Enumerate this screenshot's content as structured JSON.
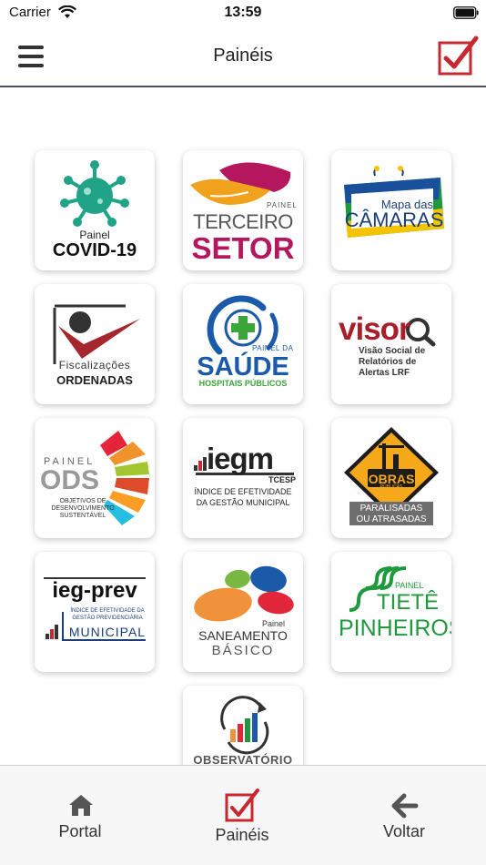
{
  "status_bar": {
    "carrier": "Carrier",
    "time": "13:59"
  },
  "nav": {
    "title": "Painéis",
    "menu_icon": "hamburger-menu-icon",
    "action_icon": "checkbox-check-icon"
  },
  "panels": {
    "covid": {
      "line1": "Painel",
      "line2": "COVID-19"
    },
    "terceiro": {
      "tag": "PAINEL",
      "line1": "TERCEIRO",
      "line2": "SETOR"
    },
    "camaras": {
      "line1": "Mapa das",
      "line2": "CÂMARAS"
    },
    "fiscalizacoes": {
      "line1": "Fiscalizações",
      "line2": "ORDENADAS"
    },
    "saude": {
      "tag": "PAINEL DA",
      "line1": "SAÚDE",
      "line2": "HOSPITAIS PÚBLICOS"
    },
    "visor": {
      "brand": "visor",
      "line1": "Visão Social de",
      "line2": "Relatórios de",
      "line3": "Alertas LRF"
    },
    "ods": {
      "tag": "PAINEL",
      "brand": "ODS",
      "line1": "OBJETIVOS DE",
      "line2": "DESENVOLVIMENTO",
      "line3": "SUSTENTÁVEL"
    },
    "iegm": {
      "brand": "iegm",
      "sub": "TCESP",
      "line1": "ÍNDICE DE EFETIVIDADE",
      "line2": "DA GESTÃO MUNICIPAL"
    },
    "obras": {
      "sign": "OBRAS",
      "sign_sub": "PÚBLICAS",
      "line1": "PARALISADAS",
      "line2": "OU ATRASADAS"
    },
    "iegprev": {
      "brand": "ieg-prev",
      "line1": "ÍNDICE DE EFETIVIDADE DA",
      "line2": "GESTÃO PREVIDENCIÁRIA",
      "line3": "MUNICIPAL"
    },
    "saneamento": {
      "tag": "Painel",
      "line1": "SANEAMENTO",
      "line2": "BÁSICO"
    },
    "tiete": {
      "tag": "PAINEL",
      "line1": "TIETÊ",
      "line2": "PINHEIROS"
    },
    "observatorio": {
      "line1": "OBSERVATÓRIO"
    }
  },
  "tabs": [
    {
      "label": "Portal",
      "icon": "home-icon"
    },
    {
      "label": "Painéis",
      "icon": "checkbox-check-icon",
      "active": true
    },
    {
      "label": "Voltar",
      "icon": "back-arrow-icon"
    }
  ],
  "colors": {
    "accent_red": "#c8282f",
    "header_rule": "#4b5156",
    "tab_text": "#333333"
  }
}
